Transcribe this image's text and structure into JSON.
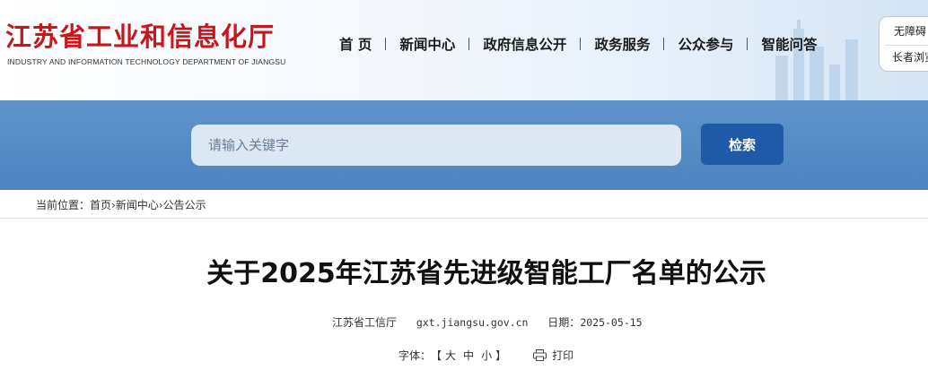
{
  "header": {
    "logo_cn": "江苏省工业和信息化厅",
    "logo_en": "INDUSTRY AND INFORMATION TECHNOLOGY DEPARTMENT OF JIANGSU",
    "nav": [
      "首 页",
      "新闻中心",
      "政府信息公开",
      "政务服务",
      "公众参与",
      "智能问答"
    ],
    "aux": {
      "accessibility": "无障碍",
      "elder": "长者浏览"
    }
  },
  "search": {
    "placeholder": "请输入关键字",
    "button": "检索"
  },
  "breadcrumb": {
    "label": "当前位置：",
    "items": [
      "首页",
      "新闻中心",
      "公告公示"
    ],
    "sep": "›"
  },
  "article": {
    "title": "关于2025年江苏省先进级智能工厂名单的公示",
    "source": "江苏省工信厅",
    "site": "gxt.jiangsu.gov.cn",
    "date_label": "日期：",
    "date": "2025-05-15",
    "font_label": "字体：",
    "bracket_open": "【",
    "size_large": "大",
    "size_medium": "中",
    "size_small": "小",
    "bracket_close": "】",
    "print": "打印"
  },
  "colors": {
    "brand_red": "#c8161d",
    "band_blue": "#4d85c1",
    "button_blue": "#1f5aa6"
  }
}
